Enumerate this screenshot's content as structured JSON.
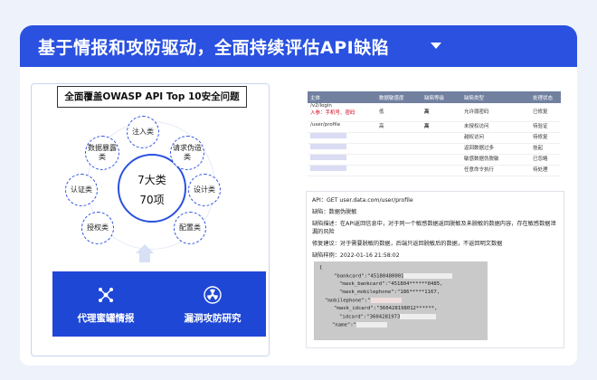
{
  "banner": {
    "title": "基于情报和攻防驱动，全面持续评估API缺陷"
  },
  "left": {
    "title": "全面覆盖OWASP API Top 10安全问题",
    "center_line1": "7大类",
    "center_line2": "70项",
    "categories": [
      "注入类",
      "请求伪造类",
      "设计类",
      "配置类",
      "授权类",
      "认证类",
      "数据暴露类"
    ],
    "boxes": [
      "代理蜜罐情报",
      "漏洞攻防研究"
    ]
  },
  "table": {
    "headers": [
      "主体",
      "数据敏感度",
      "缺陷等级",
      "缺陷类型",
      "处理状态"
    ],
    "rows": [
      {
        "subject": "/v2/login",
        "subject_note": "入参：手机号、密码",
        "sensitivity": "低",
        "level": "高",
        "type": "允许弱密码",
        "status": "已修复"
      },
      {
        "subject": "/user/profile",
        "subject_note": "",
        "sensitivity": "高",
        "level": "高",
        "type": "未授权访问",
        "status": "待验证"
      },
      {
        "subject": "",
        "subject_note": "",
        "sensitivity": "",
        "level": "",
        "type": "越权访问",
        "status": "待修复"
      },
      {
        "subject": "",
        "subject_note": "",
        "sensitivity": "",
        "level": "",
        "type": "返回数据过多",
        "status": "挂起"
      },
      {
        "subject": "",
        "subject_note": "",
        "sensitivity": "",
        "level": "",
        "type": "敏感数据伪脱敏",
        "status": "已忽略"
      },
      {
        "subject": "",
        "subject_note": "",
        "sensitivity": "",
        "level": "",
        "type": "任意命令执行",
        "status": "待处理"
      }
    ]
  },
  "detail": {
    "api": "API：GET user.data.com/user/profile",
    "defect": "缺陷：数据伪脱敏",
    "desc": "缺陷描述：在API返回信息中，对于同一个敏感数据返回脱敏及未脱敏的数据内容，存在敏感数据泄漏的风险",
    "advice": "修复建议：对于需要脱敏的数据，后端只返回脱敏后的数据，不返回明文数据",
    "sample": "缺陷样例：2022-01-16 21:58:02",
    "code": [
      "{",
      "\"bankcard\":\"45180480001",
      "\"mask_bankcard\":\"451804******0485,",
      "\"mask_mobilephone\":\"186*****1167,",
      "\"mobilephone\":\"",
      "\"mask_idcard\":\"360428198012******,",
      "\"idcard\":\"3604281973",
      "\"name\":\""
    ]
  }
}
